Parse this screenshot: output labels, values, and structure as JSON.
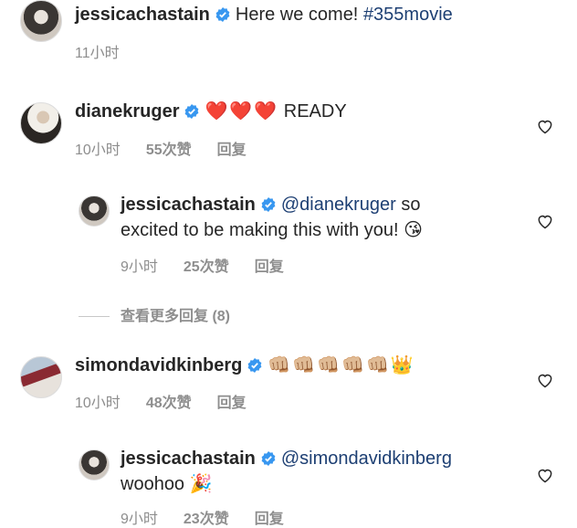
{
  "post": {
    "user": "jessicachastain",
    "caption": "Here we come! ",
    "hashtag": "#355movie",
    "time": "11小时"
  },
  "comments": [
    {
      "user": "dianekruger",
      "emoji": "❤️❤️❤️",
      "text": " READY",
      "time": "10小时",
      "likes": "55次赞",
      "reply": "回复"
    },
    {
      "user": "jessicachastain",
      "mention": "@dianekruger",
      "text_a": " so",
      "text_b": "excited to be making this with you! ",
      "emoji": "😘",
      "time": "9小时",
      "likes": "25次赞",
      "reply": "回复"
    },
    {
      "user": "simondavidkinberg",
      "emoji": "👊🏼👊🏼👊🏼👊🏼👊🏼👑",
      "time": "10小时",
      "likes": "48次赞",
      "reply": "回复"
    },
    {
      "user": "jessicachastain",
      "mention": "@simondavidkinberg",
      "text_b": "woohoo ",
      "emoji": "🎉",
      "time": "9小时",
      "likes": "23次赞",
      "reply": "回复"
    }
  ],
  "view_more": "查看更多回复 (8)",
  "colors": {
    "verified": "#3897f0",
    "link": "#1d3f73",
    "meta": "#8e8e8e"
  }
}
